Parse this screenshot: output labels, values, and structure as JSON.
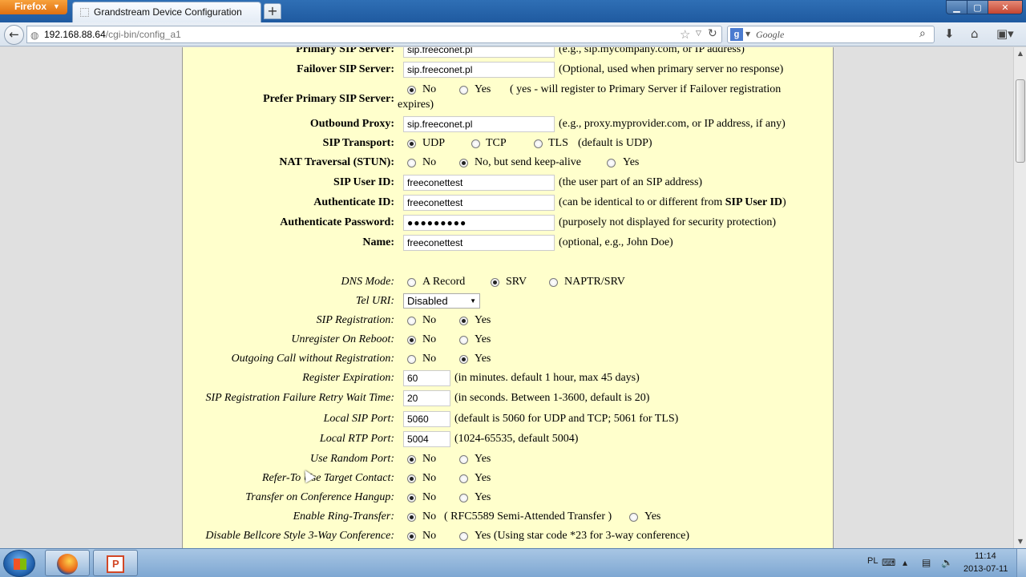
{
  "browser": {
    "app_button": "Firefox",
    "tab_title": "Grandstream Device Configuration",
    "new_tab": "+",
    "url_host": "192.168.88.64",
    "url_path": "/cgi-bin/config_a1",
    "search_engine": "g",
    "search_placeholder": "Google"
  },
  "form": {
    "primary_sip": {
      "label": "Primary SIP Server:",
      "value": "sip.freeconet.pl",
      "hint": "(e.g., sip.mycompany.com, or IP address)"
    },
    "failover_sip": {
      "label": "Failover SIP Server:",
      "value": "sip.freeconet.pl",
      "hint": "(Optional, used when primary server no response)"
    },
    "prefer_primary": {
      "label": "Prefer Primary SIP Server:",
      "no": "No",
      "yes": "Yes",
      "selected": "No",
      "hint1": "( yes - will register to Primary Server if Failover registration",
      "hint2": "expires)"
    },
    "outbound_proxy": {
      "label": "Outbound Proxy:",
      "value": "sip.freeconet.pl",
      "hint": "(e.g., proxy.myprovider.com, or IP address, if any)"
    },
    "sip_transport": {
      "label": "SIP Transport:",
      "udp": "UDP",
      "tcp": "TCP",
      "tls": "TLS",
      "selected": "UDP",
      "hint": "(default is UDP)"
    },
    "nat_traversal": {
      "label": "NAT Traversal (STUN):",
      "no": "No",
      "keepalive": "No, but send keep-alive",
      "yes": "Yes",
      "selected": "No, but send keep-alive"
    },
    "sip_user_id": {
      "label": "SIP User ID:",
      "value": "freeconettest",
      "hint": "(the user part of an SIP address)"
    },
    "auth_id": {
      "label": "Authenticate ID:",
      "value": "freeconettest",
      "hint_pre": "(can be identical to or different from ",
      "hint_bold": "SIP User ID",
      "hint_post": ")"
    },
    "auth_password": {
      "label": "Authenticate Password:",
      "value": "●●●●●●●●●",
      "hint": "(purposely not displayed for security protection)"
    },
    "name": {
      "label": "Name:",
      "value": "freeconettest",
      "hint": "(optional, e.g., John Doe)"
    },
    "dns_mode": {
      "label": "DNS Mode:",
      "a": "A Record",
      "srv": "SRV",
      "naptr": "NAPTR/SRV",
      "selected": "SRV"
    },
    "tel_uri": {
      "label": "Tel URI:",
      "value": "Disabled"
    },
    "sip_registration": {
      "label": "SIP Registration:",
      "no": "No",
      "yes": "Yes",
      "selected": "Yes"
    },
    "unregister_reboot": {
      "label": "Unregister On Reboot:",
      "no": "No",
      "yes": "Yes",
      "selected": "No"
    },
    "outgoing_no_reg": {
      "label": "Outgoing Call without Registration:",
      "no": "No",
      "yes": "Yes",
      "selected": "Yes"
    },
    "register_expiration": {
      "label": "Register Expiration:",
      "value": "60",
      "hint": "(in minutes. default 1 hour, max 45 days)"
    },
    "reg_retry_wait": {
      "label": "SIP Registration Failure Retry Wait Time:",
      "value": "20",
      "hint": "(in seconds. Between 1-3600, default is 20)"
    },
    "local_sip_port": {
      "label": "Local SIP Port:",
      "value": "5060",
      "hint": "(default is 5060 for UDP and TCP; 5061 for TLS)"
    },
    "local_rtp_port": {
      "label": "Local RTP Port:",
      "value": "5004",
      "hint": "(1024-65535, default 5004)"
    },
    "use_random_port": {
      "label": "Use Random Port:",
      "no": "No",
      "yes": "Yes",
      "selected": "No"
    },
    "refer_to_target": {
      "label": "Refer-To Use Target Contact:",
      "no": "No",
      "yes": "Yes",
      "selected": "No"
    },
    "transfer_conf_hangup": {
      "label": "Transfer on Conference Hangup:",
      "no": "No",
      "yes": "Yes",
      "selected": "No"
    },
    "ring_transfer": {
      "label": "Enable Ring-Transfer:",
      "no": "No",
      "note": "( RFC5589 Semi-Attended Transfer )",
      "yes": "Yes",
      "selected": "No"
    },
    "bellcore_3way": {
      "label": "Disable Bellcore Style 3-Way Conference:",
      "no": "No",
      "yes": "Yes (Using star code *23 for 3-way conference)",
      "selected": "No"
    }
  },
  "taskbar": {
    "language": "PL",
    "time": "11:14",
    "date": "2013-07-11"
  }
}
